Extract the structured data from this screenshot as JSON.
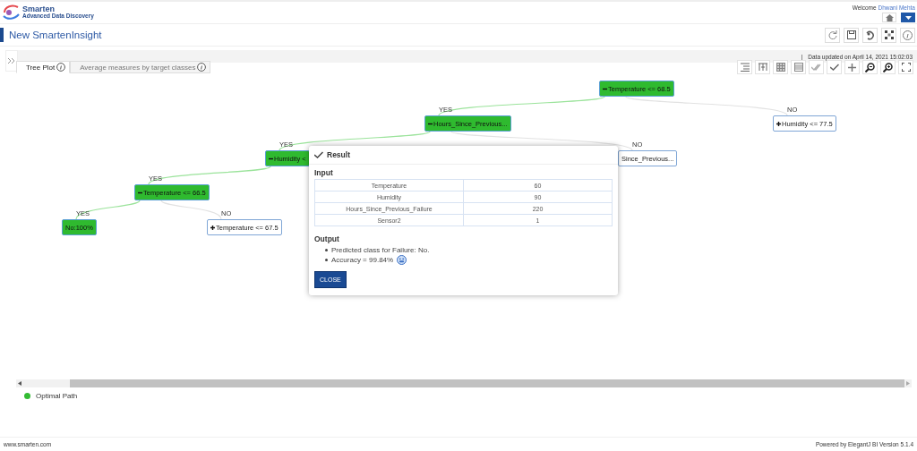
{
  "header": {
    "logo_title": "Smarten",
    "logo_subtitle": "Advanced Data Discovery",
    "welcome": "Welcome",
    "user": "Dhwani Mehta"
  },
  "title_bar": {
    "title": "New SmartenInsight"
  },
  "info_bar": {
    "separator": "|",
    "text": "Data updated on April 14, 2021 15:02:03"
  },
  "tabs": [
    {
      "label": "Tree Plot",
      "selected": true
    },
    {
      "label": "Average measures by target classes",
      "selected": false
    }
  ],
  "tree": {
    "label": "Temperature <= 68.5",
    "on_path": true,
    "expanded": true,
    "children": [
      {
        "edge": "YES",
        "label": "Hours_Since_Previous...",
        "on_path": true,
        "expanded": true,
        "children": [
          {
            "edge": "YES",
            "label": "Humidity <",
            "on_path": true,
            "expanded": true,
            "children": [
              {
                "edge": "YES",
                "label": "Temperature <= 66.5",
                "on_path": true,
                "expanded": true,
                "children": [
                  {
                    "edge": "YES",
                    "label": "No:100%",
                    "on_path": true,
                    "kind": "leaf"
                  },
                  {
                    "edge": "NO",
                    "label": "Temperature <= 67.5",
                    "on_path": false,
                    "expanded": false
                  }
                ]
              }
            ]
          },
          {
            "edge": "NO",
            "label": "Since_Previous...",
            "on_path": false,
            "kind": "leaf"
          }
        ]
      },
      {
        "edge": "NO",
        "label": "Humidity <= 77.5",
        "on_path": false,
        "expanded": false
      }
    ]
  },
  "dialog": {
    "title": "Result",
    "input_label": "Input",
    "inputs": [
      {
        "name": "Temperature",
        "value": "60"
      },
      {
        "name": "Humidity",
        "value": "90"
      },
      {
        "name": "Hours_Since_Previous_Failure",
        "value": "220"
      },
      {
        "name": "Sensor2",
        "value": "1"
      }
    ],
    "output_label": "Output",
    "outputs": [
      {
        "text": "Predicted class for Failure: No.",
        "kind": "text"
      },
      {
        "text": "Accuracy = 99.84%",
        "kind": "emoji"
      }
    ],
    "close": "CLOSE"
  },
  "legend": [
    {
      "label": "Optimal Path",
      "color": "#33bb33"
    }
  ],
  "footer": {
    "left": "www.smarten.com",
    "right": "Powered by ElegantJ BI Version 5.1.4"
  }
}
